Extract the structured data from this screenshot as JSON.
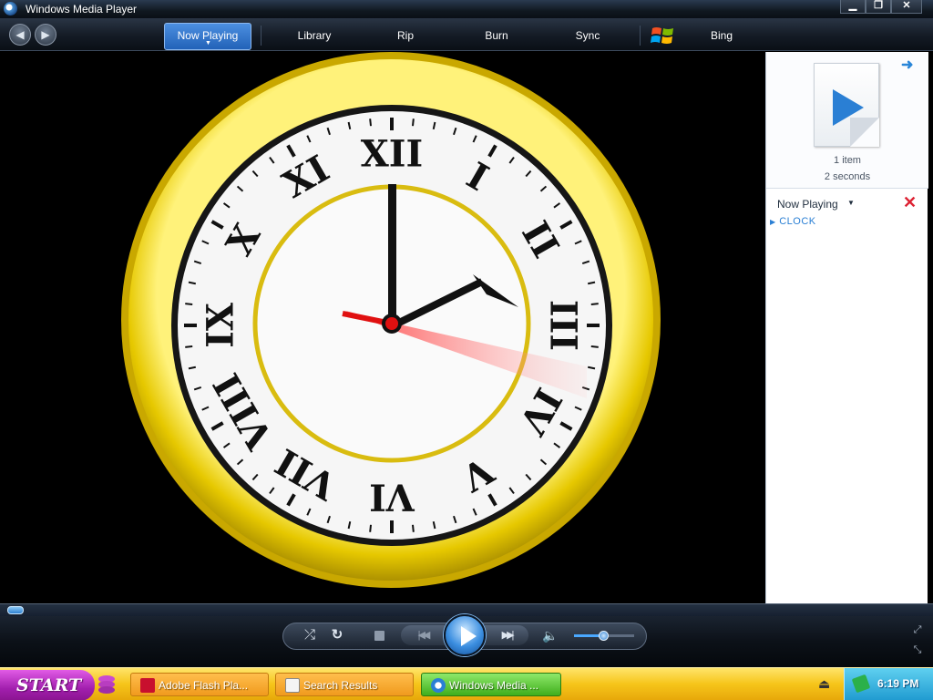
{
  "window": {
    "title": "Windows Media Player",
    "controls": {
      "minimize": "▁",
      "maximize": "❐",
      "close": "✕"
    }
  },
  "nav": {
    "back_icon": "back-arrow-icon",
    "forward_icon": "forward-arrow-icon",
    "tabs": [
      {
        "label": "Now Playing",
        "active": true
      },
      {
        "label": "Library"
      },
      {
        "label": "Rip"
      },
      {
        "label": "Burn"
      },
      {
        "label": "Sync"
      },
      {
        "label": "Bing"
      }
    ]
  },
  "video": {
    "clock_numerals": [
      "XII",
      "I",
      "II",
      "III",
      "IV",
      "V",
      "VI",
      "VII",
      "VIII",
      "IX",
      "X",
      "XI"
    ],
    "colors": {
      "rim": "#e6c800",
      "face": "#f4f4f4",
      "second_hand": "#e01010"
    }
  },
  "panel": {
    "item_count": "1 item",
    "duration": "2 seconds",
    "list_title": "Now Playing",
    "items": [
      "CLOCK"
    ]
  },
  "playback": {
    "progress": 0,
    "volume": 0.5,
    "accent": "#3b8ee0"
  },
  "taskbar": {
    "start_label": "START",
    "tasks": [
      {
        "label": "Adobe Flash Pla..."
      },
      {
        "label": "Search Results"
      },
      {
        "label": "Windows Media ...",
        "active": true
      }
    ],
    "time": "6:19 PM"
  }
}
